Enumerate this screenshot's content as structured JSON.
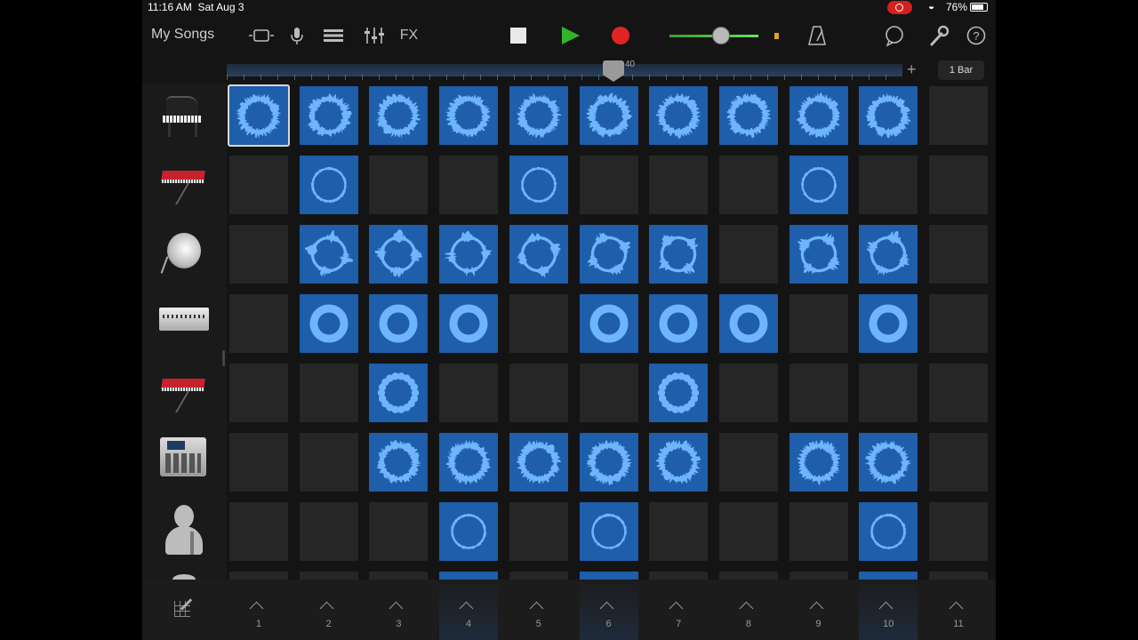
{
  "status": {
    "time": "11:16 AM",
    "date": "Sat Aug 3",
    "battery": "76%"
  },
  "toolbar": {
    "my_songs": "My Songs",
    "fx": "FX",
    "icons": [
      "browser-icon",
      "microphone-icon",
      "tracks-view-icon",
      "mixer-icon",
      "fx-button",
      "stop-icon",
      "play-icon",
      "record-icon",
      "master-volume",
      "metronome-icon",
      "loop-browser-icon",
      "settings-icon",
      "help-icon"
    ]
  },
  "ruler": {
    "position": "40",
    "length": "1 Bar",
    "add": "+"
  },
  "colors": {
    "cell_on": "#1e5eaa",
    "cell_off": "#262626",
    "wave": "#6fb4ff",
    "play": "#32b42a",
    "record": "#e02424"
  },
  "tracks": [
    {
      "name": "Grand Piano",
      "icon": "grand-piano-icon",
      "cells": [
        1,
        1,
        1,
        1,
        1,
        1,
        1,
        1,
        1,
        1,
        0
      ],
      "style": "spiky"
    },
    {
      "name": "Synth Keys",
      "icon": "keyboard-synth-icon",
      "cells": [
        0,
        1,
        0,
        0,
        1,
        0,
        0,
        0,
        1,
        0,
        0
      ],
      "style": "ring"
    },
    {
      "name": "Drums",
      "icon": "drum-icon",
      "cells": [
        0,
        1,
        1,
        1,
        1,
        1,
        1,
        0,
        1,
        1,
        0
      ],
      "style": "blobs"
    },
    {
      "name": "Drum Machine",
      "icon": "drum-machine-icon",
      "cells": [
        0,
        1,
        1,
        1,
        0,
        1,
        1,
        1,
        0,
        1,
        0
      ],
      "style": "thick"
    },
    {
      "name": "Synth Keys 2",
      "icon": "keyboard-synth-icon",
      "cells": [
        0,
        0,
        1,
        0,
        0,
        0,
        1,
        0,
        0,
        0,
        0
      ],
      "style": "dots"
    },
    {
      "name": "Beat Sequencer",
      "icon": "sampler-mpc-icon",
      "cells": [
        0,
        0,
        1,
        1,
        1,
        1,
        1,
        0,
        1,
        1,
        0
      ],
      "style": "spiky"
    },
    {
      "name": "Vocals",
      "icon": "singer-icon",
      "cells": [
        0,
        0,
        0,
        1,
        0,
        1,
        0,
        0,
        0,
        1,
        0
      ],
      "style": "ring"
    },
    {
      "name": "Partial",
      "icon": "partial-icon",
      "cells": [
        0,
        0,
        0,
        1,
        0,
        1,
        0,
        0,
        0,
        1,
        0
      ],
      "style": "ring"
    }
  ],
  "selected_cell": {
    "row": 0,
    "col": 0
  },
  "scenes": [
    "1",
    "2",
    "3",
    "4",
    "5",
    "6",
    "7",
    "8",
    "9",
    "10",
    "11"
  ],
  "highlighted_scenes": [
    3,
    5,
    9
  ]
}
